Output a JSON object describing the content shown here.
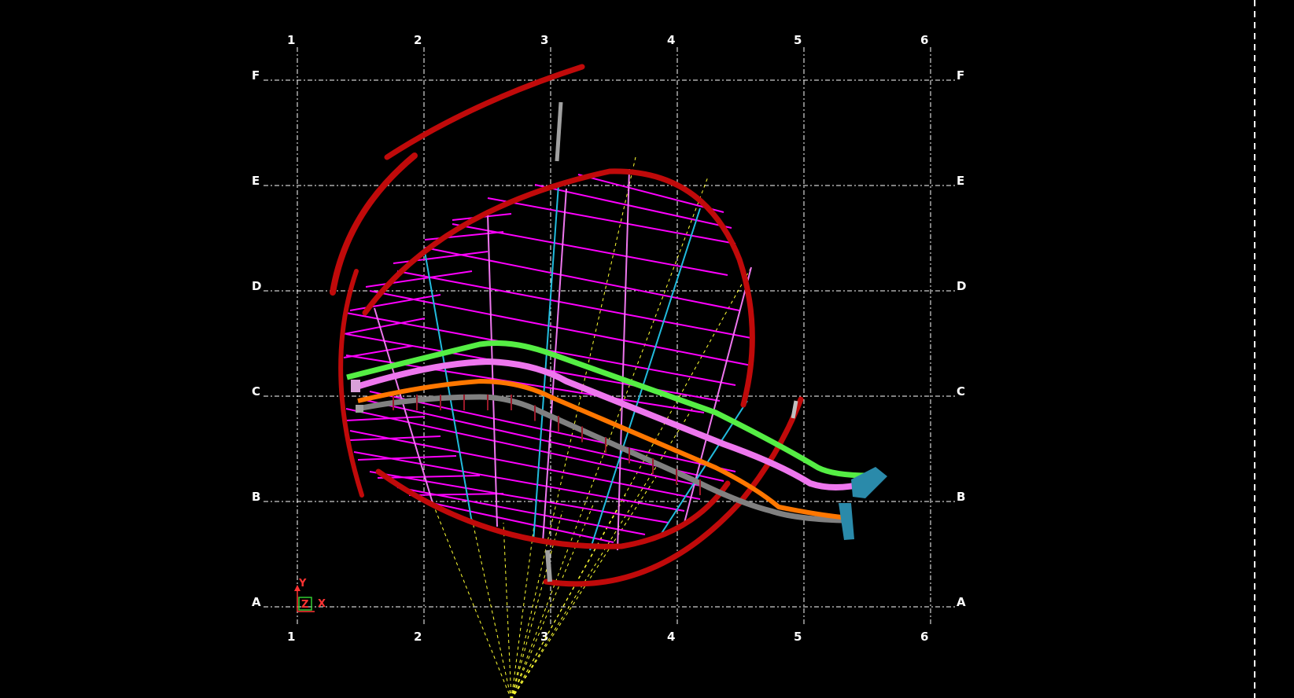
{
  "viewport": {
    "background": "#000000",
    "grid": {
      "columns": [
        "1",
        "2",
        "3",
        "4",
        "5",
        "6"
      ],
      "rows": [
        "F",
        "E",
        "D",
        "C",
        "B",
        "A"
      ],
      "line_color": "#ffffff"
    },
    "axis_triad": {
      "y_label": "Y",
      "x_label": "X",
      "z_label": "Z",
      "y_color": "#ff3333",
      "x_color": "#ff3333",
      "z_color": "#33cc33"
    },
    "colors": {
      "red_frame": "#c00a0a",
      "magenta_joist": "#ff00ff",
      "violet_line": "#ee77ee",
      "cyan_line": "#22bbdd",
      "yellow_ray": "#ffff33",
      "green_beam": "#55ee44",
      "pink_beam": "#ee77ee",
      "orange_beam": "#ff7700",
      "gray_beam": "#808080",
      "teal_block": "#2a8aaa",
      "dark_red_tick": "#9a1a2a",
      "gray_post": "#a0a0a0"
    }
  }
}
